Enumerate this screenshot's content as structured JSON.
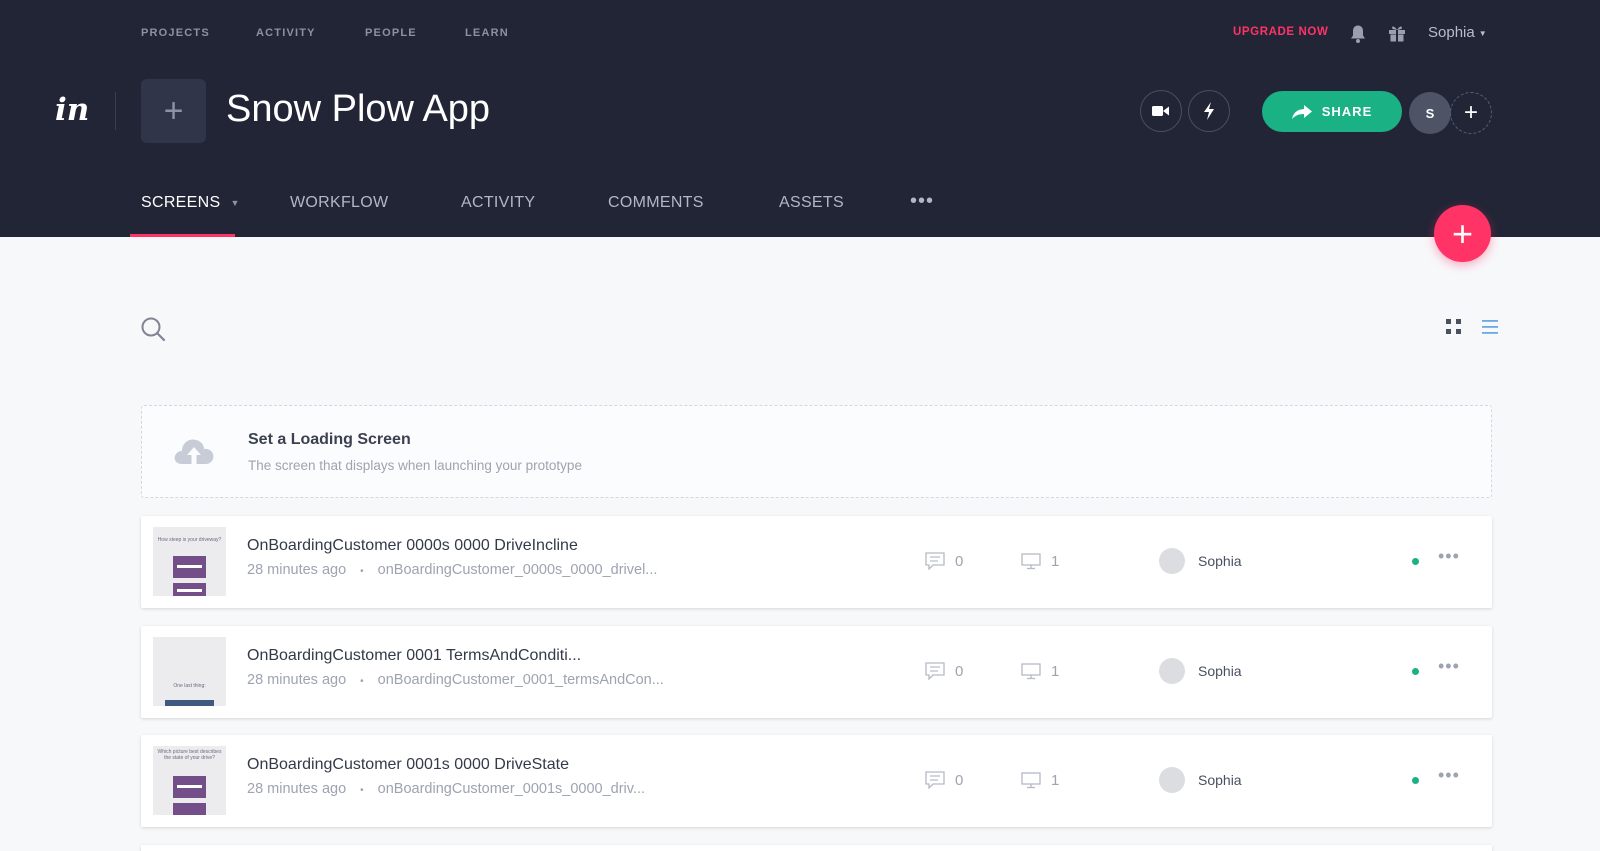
{
  "top_nav": {
    "items": [
      {
        "label": "PROJECTS"
      },
      {
        "label": "ACTIVITY"
      },
      {
        "label": "PEOPLE"
      },
      {
        "label": "LEARN"
      }
    ],
    "upgrade_label": "UPGRADE NOW",
    "user_name": "Sophia"
  },
  "brand": {
    "logo_text": "in"
  },
  "project": {
    "title": "Snow Plow App",
    "share_label": "SHARE",
    "member_initial": "S"
  },
  "tabs": [
    {
      "label": "SCREENS",
      "active": true
    },
    {
      "label": "WORKFLOW"
    },
    {
      "label": "ACTIVITY"
    },
    {
      "label": "COMMENTS"
    },
    {
      "label": "ASSETS"
    }
  ],
  "loading_screen": {
    "title": "Set a Loading Screen",
    "subtitle": "The screen that displays when launching your prototype"
  },
  "screens": [
    {
      "name": "OnBoardingCustomer 0000s 0000 DriveIncline",
      "time": "28 minutes ago",
      "file": "onBoardingCustomer_0000s_0000_drivel...",
      "comments": "0",
      "screens": "1",
      "owner": "Sophia",
      "thumb_text": "How steep is your driveway?"
    },
    {
      "name": "OnBoardingCustomer 0001 TermsAndConditi...",
      "time": "28 minutes ago",
      "file": "onBoardingCustomer_0001_termsAndCon...",
      "comments": "0",
      "screens": "1",
      "owner": "Sophia",
      "thumb_text": "One last thing:"
    },
    {
      "name": "OnBoardingCustomer 0001s 0000 DriveState",
      "time": "28 minutes ago",
      "file": "onBoardingCustomer_0001s_0000_driv...",
      "comments": "0",
      "screens": "1",
      "owner": "Sophia",
      "thumb_text": "Which picture best describes the state of your drive?"
    }
  ],
  "colors": {
    "header_bg": "#222536",
    "accent_pink": "#ff3366",
    "share_green": "#1ab184",
    "status_green": "#1ab184"
  },
  "icons": [
    "bell-icon",
    "gift-icon",
    "video-icon",
    "lightning-icon",
    "share-arrow-icon",
    "search-icon",
    "grid-view-icon",
    "list-view-icon",
    "cloud-upload-icon",
    "comment-icon",
    "monitor-icon",
    "more-icon"
  ]
}
